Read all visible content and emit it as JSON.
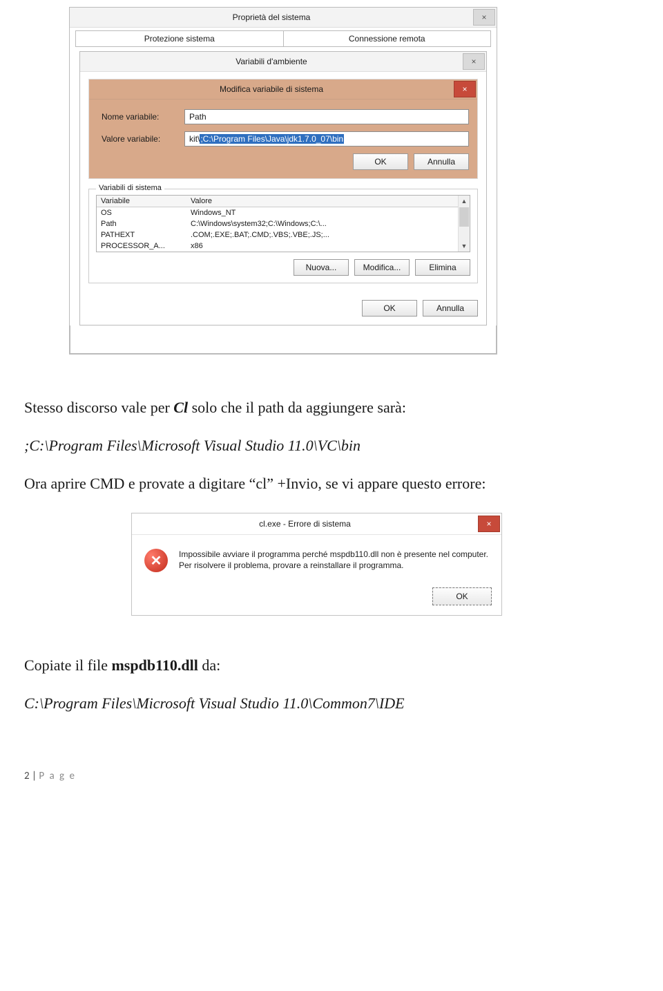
{
  "sysprops": {
    "title": "Proprietà del sistema",
    "tabs": [
      "Protezione sistema",
      "Connessione remota"
    ]
  },
  "envvars": {
    "title": "Variabili d'ambiente",
    "footer_ok": "OK",
    "footer_cancel": "Annulla"
  },
  "editvar": {
    "title": "Modifica variabile di sistema",
    "name_label": "Nome variabile:",
    "name_value": "Path",
    "value_label": "Valore variabile:",
    "value_prefix": "kit\\",
    "value_selected": ";C:\\Program Files\\Java\\jdk1.7.0_07\\bin",
    "ok": "OK",
    "cancel": "Annulla"
  },
  "sysvars": {
    "caption": "Variabili di sistema",
    "hdr_var": "Variabile",
    "hdr_val": "Valore",
    "rows": [
      {
        "v": "OS",
        "val": "Windows_NT"
      },
      {
        "v": "Path",
        "val": "C:\\Windows\\system32;C:\\Windows;C:\\..."
      },
      {
        "v": "PATHEXT",
        "val": ".COM;.EXE;.BAT;.CMD;.VBS;.VBE;.JS;..."
      },
      {
        "v": "PROCESSOR_A...",
        "val": "x86"
      }
    ],
    "btn_new": "Nuova...",
    "btn_edit": "Modifica...",
    "btn_del": "Elimina"
  },
  "para1": {
    "t1": "Stesso discorso vale per ",
    "cl": "Cl",
    "t2": " solo che il path da aggiungere sarà:",
    "path": ";C:\\Program Files\\Microsoft Visual Studio 11.0\\VC\\bin",
    "t3": "Ora aprire CMD e provate a digitare “cl” +Invio, se vi appare questo errore:"
  },
  "errdlg": {
    "title": "cl.exe - Errore di sistema",
    "msg": "Impossibile avviare il programma perché mspdb110.dll non è presente nel computer. Per risolvere il problema, provare a reinstallare il programma.",
    "ok": "OK"
  },
  "para2": {
    "t1": "Copiate il file ",
    "file": "mspdb110.dll",
    "t2": " da:",
    "path": "C:\\Program Files\\Microsoft Visual Studio 11.0\\Common7\\IDE"
  },
  "footer": {
    "num": "2",
    "sep": " | ",
    "word": "P a g e"
  }
}
